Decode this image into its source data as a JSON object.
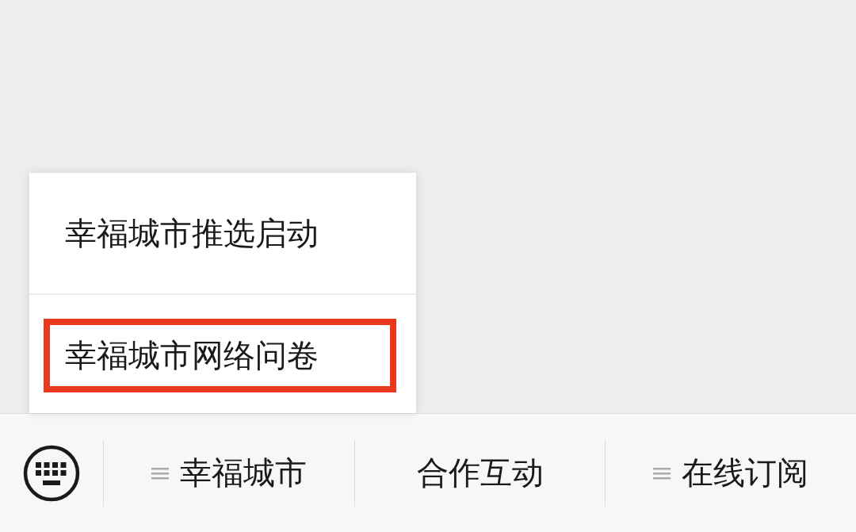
{
  "popup_menu": {
    "items": [
      {
        "label": "幸福城市推选启动",
        "highlighted": false
      },
      {
        "label": "幸福城市网络问卷",
        "highlighted": true
      }
    ]
  },
  "bottom_bar": {
    "menus": [
      {
        "label": "幸福城市",
        "has_submenu": true
      },
      {
        "label": "合作互动",
        "has_submenu": false
      },
      {
        "label": "在线订阅",
        "has_submenu": true
      }
    ]
  }
}
